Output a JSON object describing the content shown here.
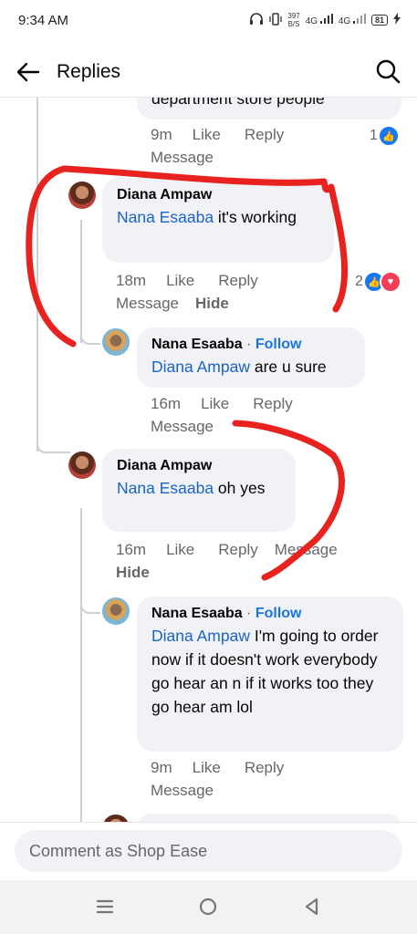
{
  "status": {
    "time": "9:34 AM",
    "speed": "397",
    "speed_unit": "B/S",
    "net1": "4G",
    "net2": "4G",
    "battery": "81"
  },
  "header": {
    "title": "Replies"
  },
  "comments": [
    {
      "text": "department store people",
      "time": "9m",
      "like": "Like",
      "reply": "Reply",
      "message": "Message",
      "reactions": "1"
    },
    {
      "author": "Diana Ampaw",
      "mention": "Nana Esaaba",
      "text": " it's working",
      "time": "18m",
      "like": "Like",
      "reply": "Reply",
      "message": "Message",
      "hide": "Hide",
      "reactions": "2"
    },
    {
      "author": "Nana Esaaba",
      "follow": "Follow",
      "mention": "Diana Ampaw",
      "text": " are u sure",
      "time": "16m",
      "like": "Like",
      "reply": "Reply",
      "message": "Message"
    },
    {
      "author": "Diana Ampaw",
      "mention": "Nana Esaaba",
      "text": " oh yes",
      "time": "16m",
      "like": "Like",
      "reply": "Reply",
      "message": "Message",
      "hide": "Hide"
    },
    {
      "author": "Nana Esaaba",
      "follow": "Follow",
      "mention": "Diana Ampaw",
      "text": " I'm going to order now if it doesn't work everybody go hear an n if it works too they go hear am lol",
      "time": "9m",
      "like": "Like",
      "reply": "Reply",
      "message": "Message"
    }
  ],
  "composer": {
    "placeholder": "Comment as Shop Ease"
  },
  "colors": {
    "accent": "#1b74e4",
    "scribble": "#e8231f",
    "bubble": "#f0f2f5"
  }
}
